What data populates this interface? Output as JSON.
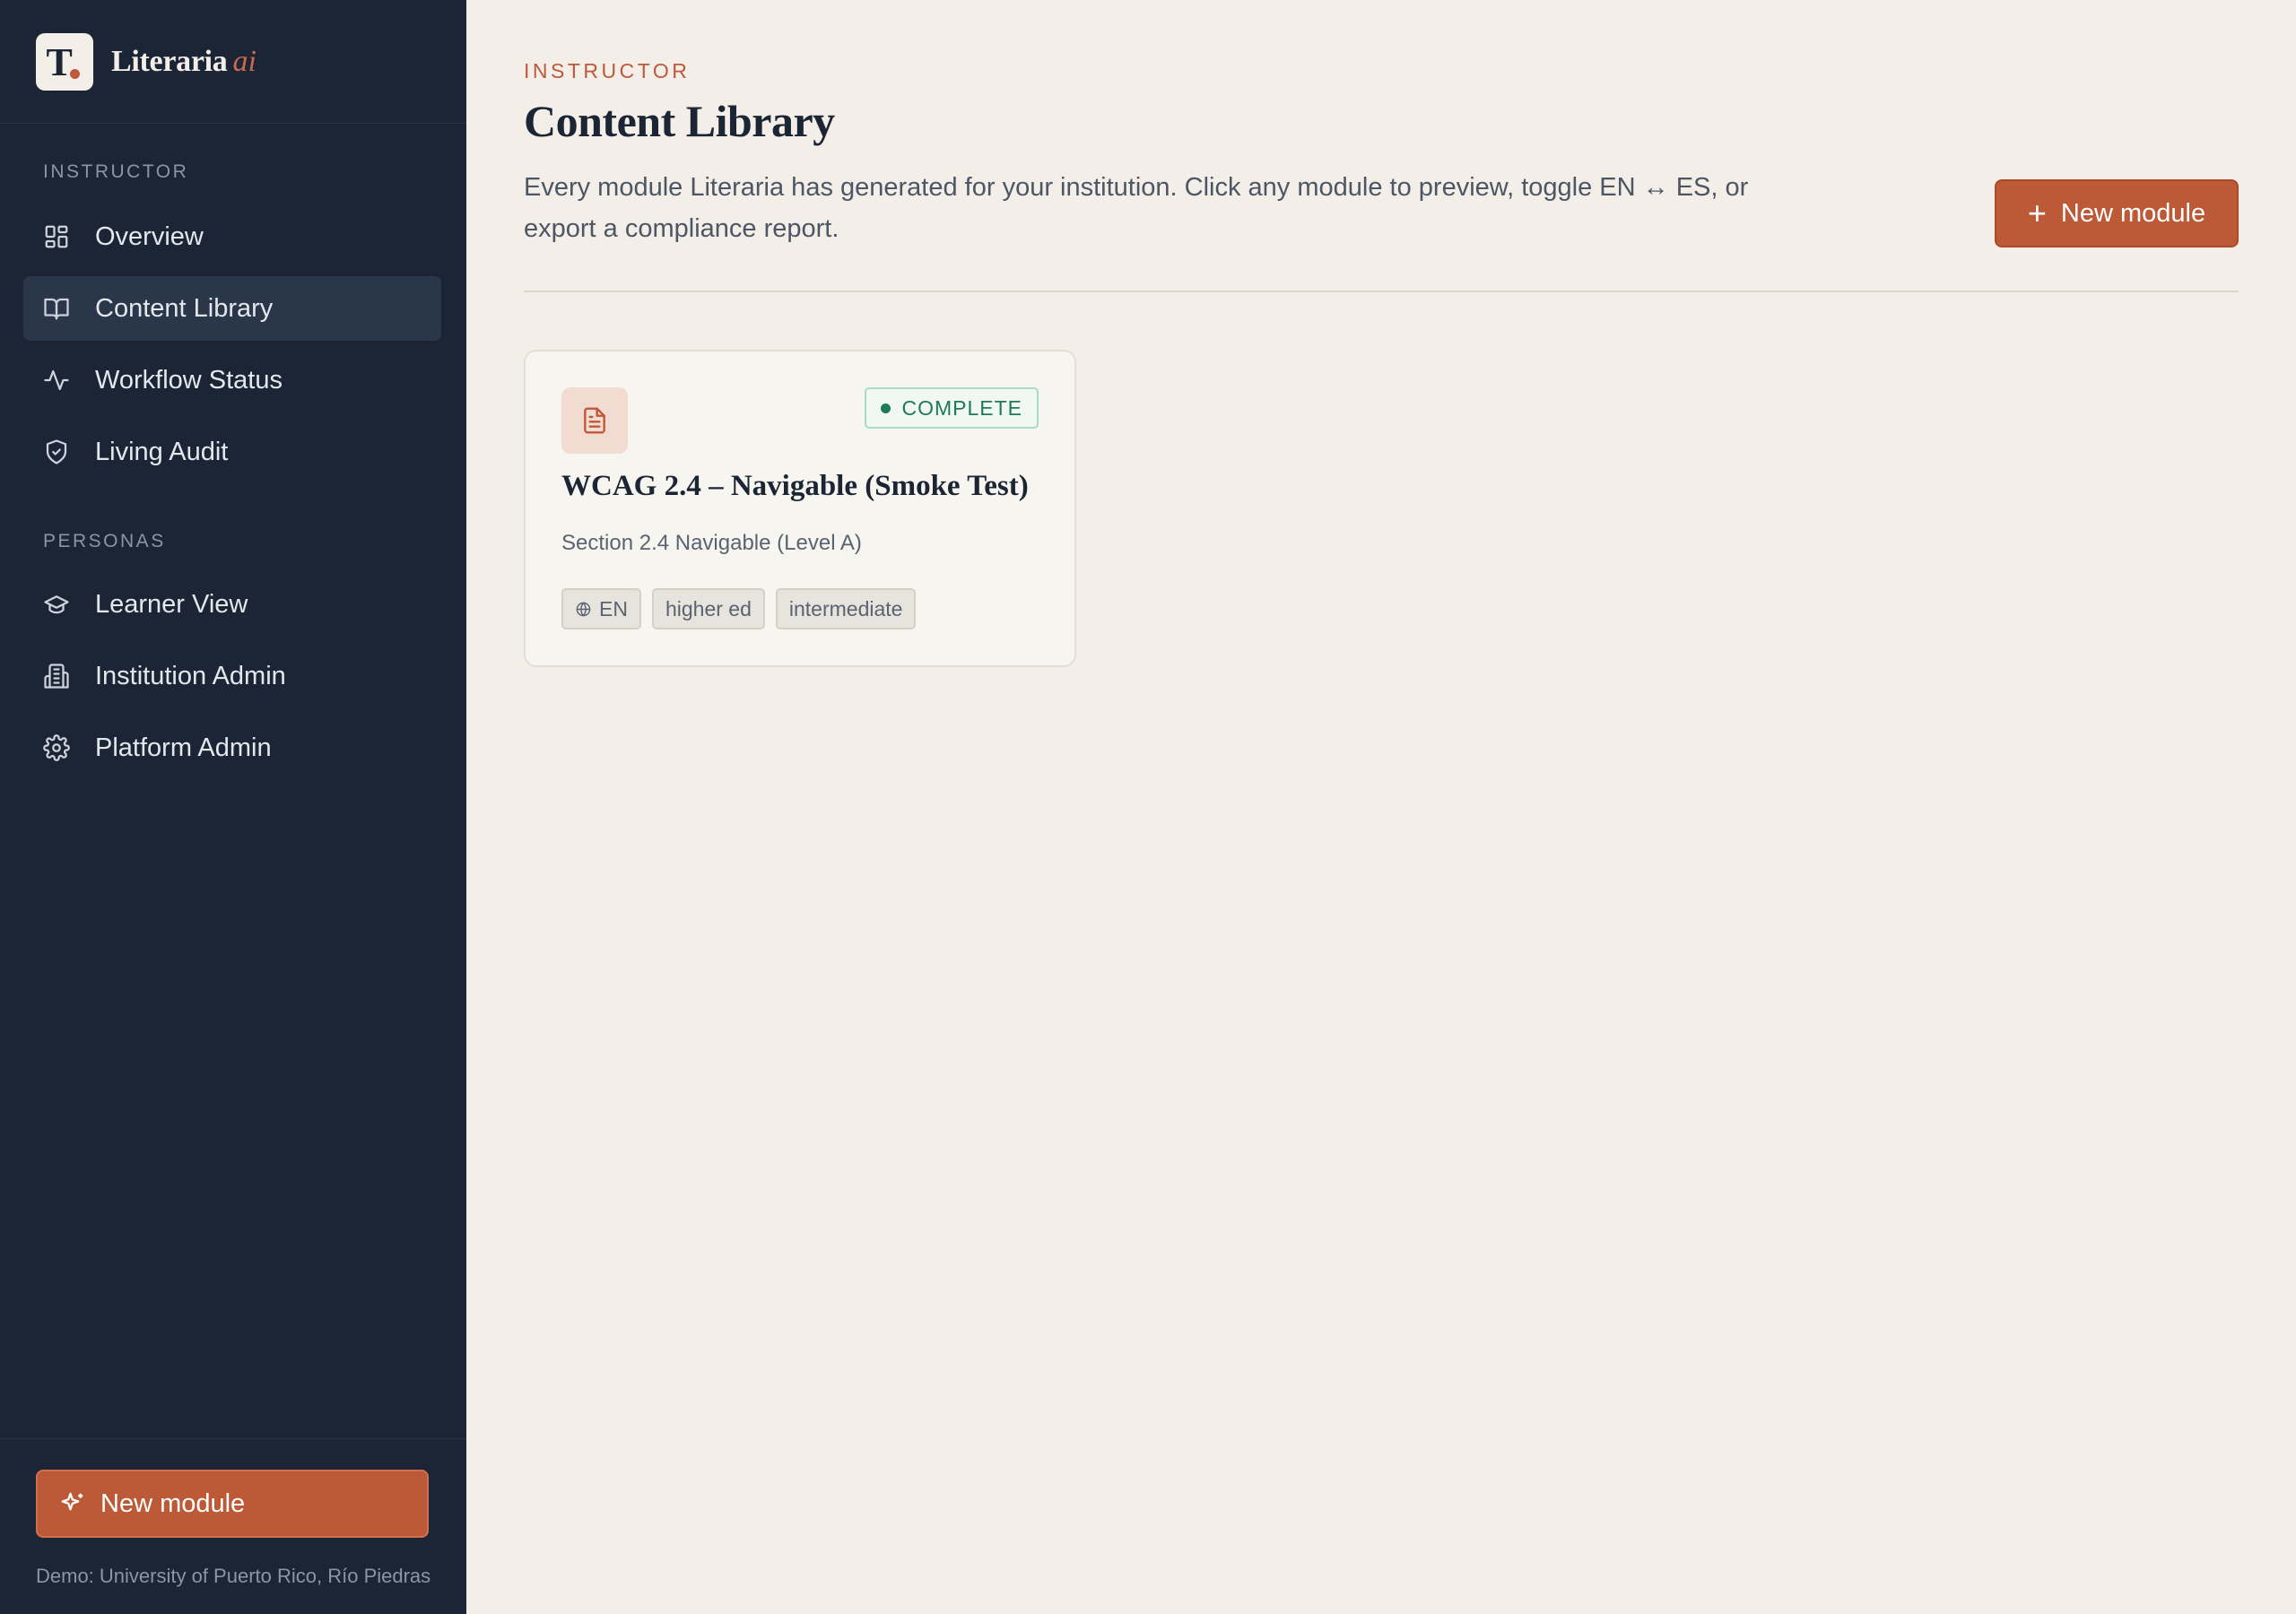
{
  "brand": {
    "logo_letter": "T.",
    "name": "Literaria",
    "suffix": "ai"
  },
  "sidebar": {
    "section_instructor": "INSTRUCTOR",
    "instructor_items": [
      {
        "label": "Overview",
        "icon": "grid-icon",
        "active": false
      },
      {
        "label": "Content Library",
        "icon": "book-icon",
        "active": true
      },
      {
        "label": "Workflow Status",
        "icon": "activity-icon",
        "active": false
      },
      {
        "label": "Living Audit",
        "icon": "shield-icon",
        "active": false
      }
    ],
    "section_personas": "PERSONAS",
    "persona_items": [
      {
        "label": "Learner View",
        "icon": "graduation-cap-icon"
      },
      {
        "label": "Institution Admin",
        "icon": "building-icon"
      },
      {
        "label": "Platform Admin",
        "icon": "gear-icon"
      }
    ],
    "new_module_label": "New module",
    "demo_note": "Demo: University of Puerto Rico, Río Piedras"
  },
  "header": {
    "eyebrow": "INSTRUCTOR",
    "title": "Content Library",
    "description": "Every module Literaria has generated for your institution. Click any module to preview, toggle EN ↔ ES, or export a compliance report.",
    "new_module_label": "New module"
  },
  "modules": [
    {
      "status": "COMPLETE",
      "title": "WCAG 2.4 – Navigable (Smoke Test)",
      "subtitle": "Section 2.4 Navigable (Level A)",
      "tags": [
        "EN",
        "higher ed",
        "intermediate"
      ]
    }
  ],
  "colors": {
    "sidebar_bg": "#1b2535",
    "page_bg": "#f3eee8",
    "accent": "#bc5a37",
    "status_complete": "#1e7a58"
  }
}
